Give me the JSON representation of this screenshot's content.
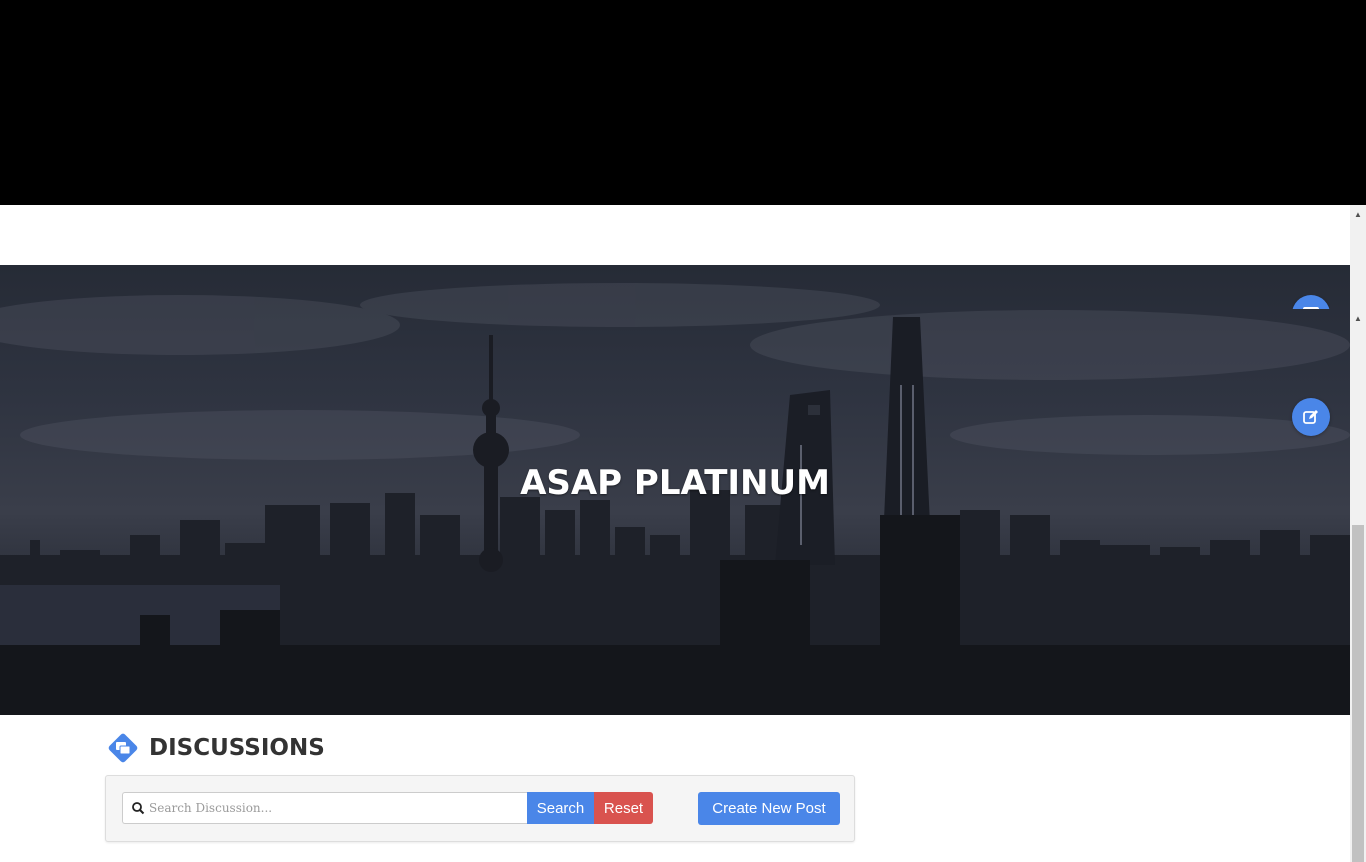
{
  "hero": {
    "title": "ASAP PLATINUM"
  },
  "floating_buttons": {
    "top_icon": "calendar-icon",
    "edit_icon": "edit-icon"
  },
  "discussions": {
    "title": "DISCUSSIONS",
    "icon": "discussion-icon",
    "search": {
      "placeholder": "Search Discussion...",
      "value": "",
      "icon": "search-icon"
    },
    "search_button": "Search",
    "reset_button": "Reset",
    "create_button": "Create New Post"
  },
  "colors": {
    "primary": "#4a86e8",
    "danger": "#d9534f",
    "heading": "#333333"
  }
}
